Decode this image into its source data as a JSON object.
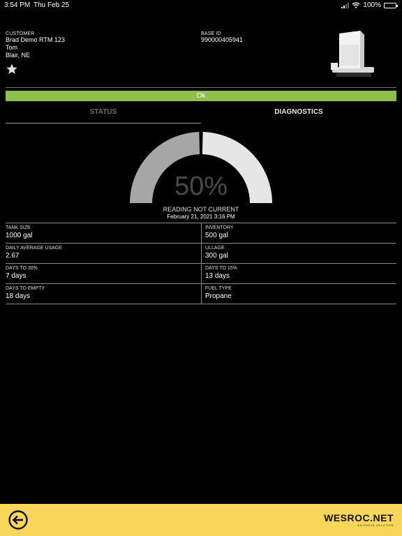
{
  "status_bar": {
    "time": "3:54 PM",
    "date": "Thu Feb 25",
    "battery": "100%",
    "battery_level": 1.0
  },
  "customer": {
    "label": "CUSTOMER",
    "name": "Brad Demo RTM 123",
    "contact": "Tom",
    "location": "Blair, NE"
  },
  "base": {
    "label": "BASE ID",
    "value": "990000405941"
  },
  "status_banner": {
    "text": "Ok",
    "color": "#8fc04a"
  },
  "tabs": [
    {
      "label": "STATUS",
      "active": false
    },
    {
      "label": "DIAGNOSTICS",
      "active": true
    }
  ],
  "gauge": {
    "percent_text": "50%",
    "level": 0.5,
    "filled_color": "#a6a6a6",
    "empty_color": "#e6e6e6",
    "reading_status": "READING NOT CURRENT",
    "reading_date": "February 21, 2021 3:16 PM"
  },
  "metrics": [
    [
      {
        "label": "TANK SIZE",
        "value": "1000 gal"
      },
      {
        "label": "INVENTORY",
        "value": "500 gal"
      }
    ],
    [
      {
        "label": "DAILY AVERAGE USAGE",
        "value": "2.67"
      },
      {
        "label": "ULLAGE",
        "value": "300 gal"
      }
    ],
    [
      {
        "label": "DAYS TO 30%",
        "value": "7 days"
      },
      {
        "label": "DAYS TO 15%",
        "value": "13 days"
      }
    ],
    [
      {
        "label": "DAYS TO EMPTY",
        "value": "18 days"
      },
      {
        "label": "FUEL TYPE",
        "value": "Propane"
      }
    ]
  ],
  "footer": {
    "brand": "WESROC.NET",
    "tagline": "AN ANOVA SOLUTION",
    "background": "#f7d65a"
  },
  "icons": {
    "favorite": "star-icon",
    "back": "back-arrow-icon",
    "device": "tank-monitor-device-icon"
  }
}
